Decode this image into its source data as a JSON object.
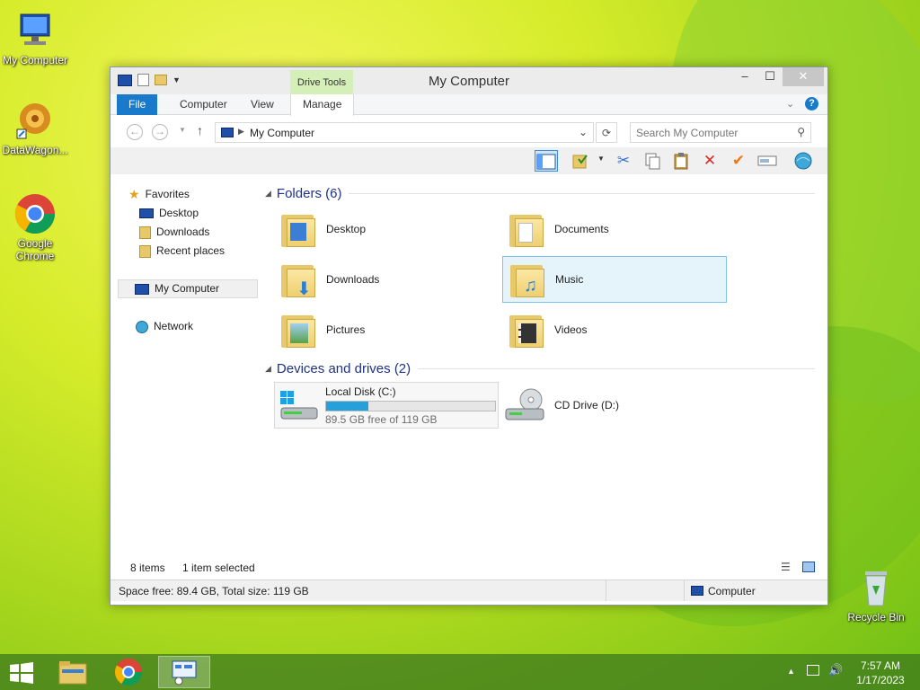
{
  "desktop": {
    "icons": [
      {
        "label": "My Computer"
      },
      {
        "label": "DataWagon..."
      },
      {
        "label": "Google Chrome"
      },
      {
        "label": "Recycle Bin"
      }
    ]
  },
  "window": {
    "title": "My Computer",
    "controls": {
      "minimize": "–",
      "maximize": "☐",
      "close": "✕"
    },
    "ribbon": {
      "context_group": "Drive Tools",
      "tabs": [
        {
          "label": "File"
        },
        {
          "label": "Computer"
        },
        {
          "label": "View"
        },
        {
          "label": "Manage"
        }
      ]
    },
    "address": {
      "path": "My Computer"
    },
    "search": {
      "placeholder": "Search My Computer"
    },
    "nav": {
      "favorites": "Favorites",
      "favorites_items": [
        {
          "label": "Desktop"
        },
        {
          "label": "Downloads"
        },
        {
          "label": "Recent places"
        }
      ],
      "computer": "My Computer",
      "network": "Network"
    },
    "content": {
      "folders_header": "Folders (6)",
      "folders": [
        {
          "label": "Desktop"
        },
        {
          "label": "Documents"
        },
        {
          "label": "Downloads"
        },
        {
          "label": "Music"
        },
        {
          "label": "Pictures"
        },
        {
          "label": "Videos"
        }
      ],
      "drives_header": "Devices and drives (2)",
      "drives": [
        {
          "label": "Local Disk (C:)",
          "free_text": "89.5 GB free of 119 GB",
          "used_fraction": 0.248
        },
        {
          "label": "CD Drive (D:)"
        }
      ]
    },
    "status": {
      "items": "8 items",
      "selected": "1 item selected",
      "space": "Space free: 89.4 GB, Total size: 119 GB",
      "location": "Computer"
    }
  },
  "taskbar": {
    "time": "7:57 AM",
    "date": "1/17/2023"
  },
  "colors": {
    "accent": "#1979ca",
    "drive_tools": "#d4efb7",
    "selection": "#e5f3fb",
    "bar_fill": "#26a0da"
  }
}
